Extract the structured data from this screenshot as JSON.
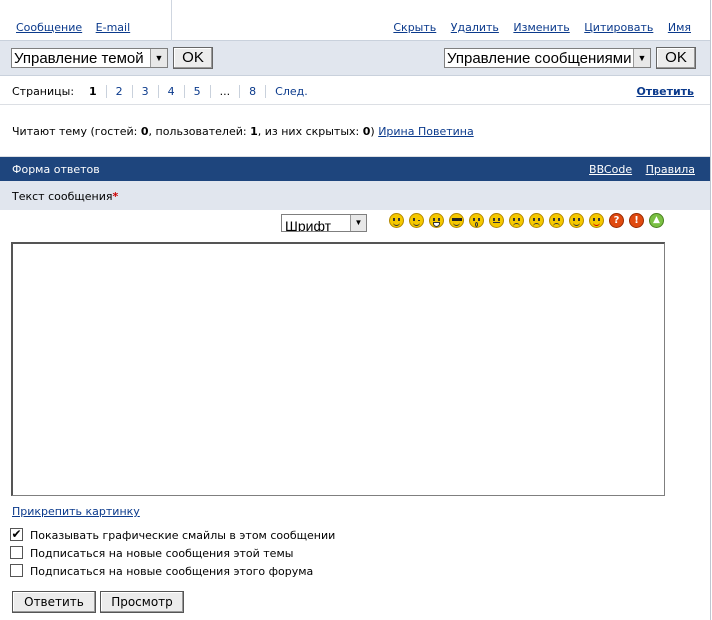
{
  "top_links": {
    "left": [
      "Сообщение",
      "E-mail"
    ],
    "right": [
      "Скрыть",
      "Удалить",
      "Изменить",
      "Цитировать",
      "Имя"
    ]
  },
  "controls": {
    "topic_select": "Управление темой",
    "message_select": "Управление сообщениями",
    "ok_label": "OK"
  },
  "pagination": {
    "label": "Страницы:",
    "current": "1",
    "pages": [
      "2",
      "3",
      "4",
      "5",
      "...",
      "8"
    ],
    "next": "След.",
    "reply_link": "Ответить"
  },
  "readers": {
    "prefix": "Читают тему (гостей: ",
    "guests": "0",
    "mid1": ", пользователей: ",
    "users": "1",
    "mid2": ", из них скрытых: ",
    "hidden": "0",
    "suffix": ")",
    "user_name": "Ирина Поветина"
  },
  "form": {
    "title": "Форма ответов",
    "bbcode": "BBCode",
    "rules": "Правила",
    "message_label": "Текст сообщения",
    "required_mark": "*",
    "font_select": "Шрифт",
    "message_value": "",
    "attach_link": "Прикрепить картинку"
  },
  "smileys": [
    "smile-icon",
    "wink-icon",
    "laugh-icon",
    "cool-icon",
    "surprised-icon",
    "neutral-icon",
    "sad-icon",
    "angry-icon",
    "cry-icon",
    "confused-icon",
    "tongue-icon",
    "question-icon",
    "exclamation-icon",
    "idea-icon"
  ],
  "options": [
    {
      "label": "Показывать графические смайлы в этом сообщении",
      "checked": true
    },
    {
      "label": "Подписаться на новые сообщения этой темы",
      "checked": false
    },
    {
      "label": "Подписаться на новые сообщения этого форума",
      "checked": false
    }
  ],
  "buttons": {
    "reply": "Ответить",
    "preview": "Просмотр"
  }
}
